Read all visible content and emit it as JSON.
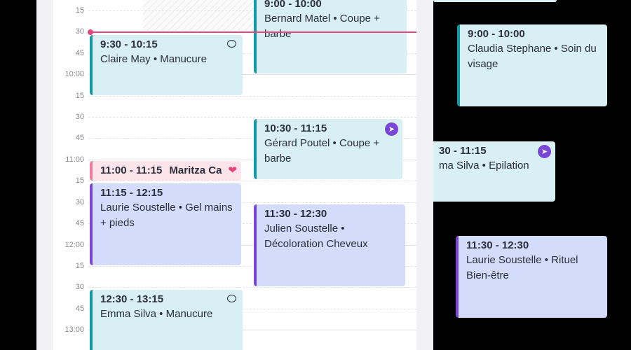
{
  "timeline": {
    "labels": [
      "15",
      "30",
      "45",
      "10:00",
      "15",
      "30",
      "45",
      "11:00",
      "15",
      "30",
      "45",
      "12:00",
      "15",
      "30",
      "45",
      "13:00"
    ]
  },
  "left_column": {
    "events": [
      {
        "time": "9:30 - 10:15",
        "desc": "Claire May • Manucure",
        "icon": "comment-icon"
      },
      {
        "time": "11:00 - 11:15",
        "name": "Maritza Ca",
        "icon": "heart-icon"
      },
      {
        "time": "11:15 - 12:15",
        "desc": "Laurie Soustelle •  Gel mains + pieds"
      },
      {
        "time": "12:30 - 13:15",
        "desc": "Emma Silva • Manucure",
        "icon": "comment-icon"
      }
    ]
  },
  "middle_column": {
    "events": [
      {
        "time": "9:00 - 10:00",
        "desc": "Bernard Matel • Coupe + barbe"
      },
      {
        "time": "10:30 - 11:15",
        "desc": "Gérard Poutel • Coupe + barbe",
        "icon": "rocket-icon"
      },
      {
        "time": "11:30 - 12:30",
        "desc": "Julien Soustelle • Décoloration Cheveux"
      }
    ]
  },
  "right_column": {
    "events": [
      {
        "time": "9:00 - 10:00",
        "desc": "Claudia Stephane • Soin du visage"
      },
      {
        "time": "30 - 11:15",
        "desc": "ma Silva • Epilation",
        "icon": "rocket-icon"
      },
      {
        "time": "11:30 - 12:30",
        "desc": "Laurie Soustelle • Rituel Bien-être"
      }
    ]
  },
  "colors": {
    "teal": "#119aa3",
    "purple": "#7b45d8",
    "pink": "#f07aa0",
    "now_line": "#e5457b"
  }
}
